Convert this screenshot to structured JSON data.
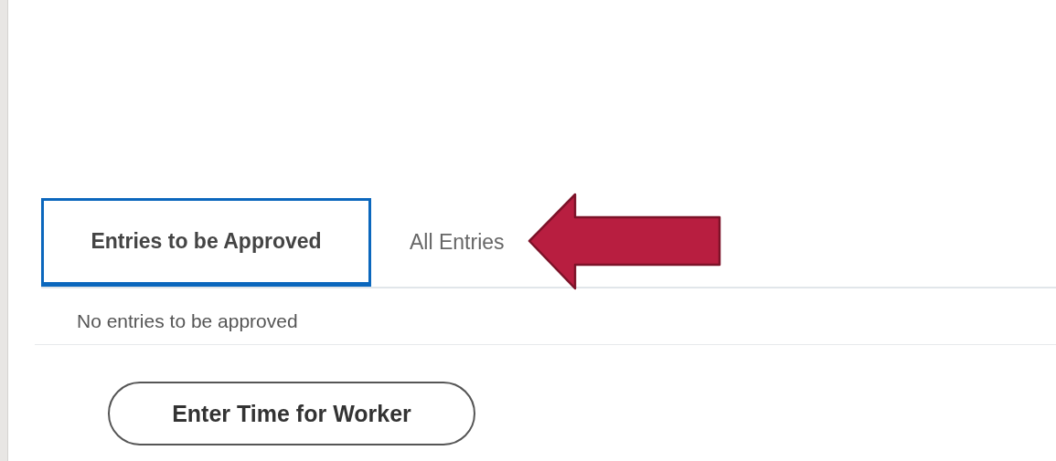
{
  "tabs": [
    {
      "label": "Entries to be Approved",
      "selected": true
    },
    {
      "label": "All Entries",
      "selected": false
    }
  ],
  "message": "No entries to be approved",
  "buttons": [
    "Enter Time for Worker"
  ],
  "annotation": {
    "kind": "arrow"
  }
}
